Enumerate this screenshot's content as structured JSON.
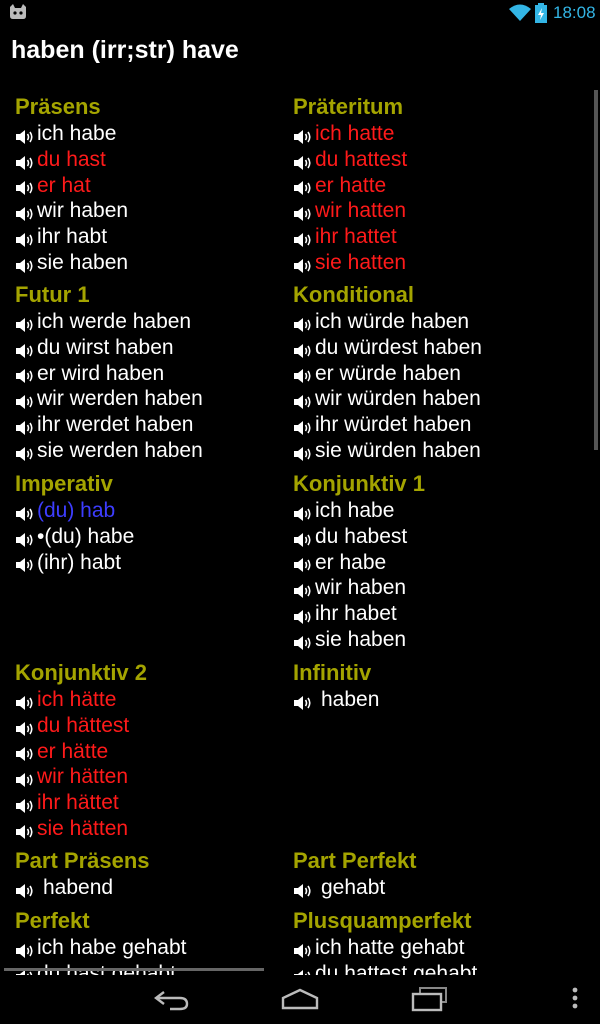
{
  "status": {
    "time": "18:08"
  },
  "title": "haben (irr;str) have",
  "sections": {
    "praesens": {
      "heading": "Präsens",
      "forms": [
        {
          "text": "ich habe",
          "irregular": false
        },
        {
          "text": "du hast",
          "irregular": true
        },
        {
          "text": "er hat",
          "irregular": true
        },
        {
          "text": "wir haben",
          "irregular": false
        },
        {
          "text": "ihr habt",
          "irregular": false
        },
        {
          "text": "sie haben",
          "irregular": false
        }
      ]
    },
    "praeteritum": {
      "heading": "Präteritum",
      "forms": [
        {
          "text": "ich hatte",
          "irregular": true
        },
        {
          "text": "du hattest",
          "irregular": true
        },
        {
          "text": "er hatte",
          "irregular": true
        },
        {
          "text": "wir hatten",
          "irregular": true
        },
        {
          "text": "ihr hattet",
          "irregular": true
        },
        {
          "text": "sie hatten",
          "irregular": true
        }
      ]
    },
    "futur1": {
      "heading": "Futur 1",
      "forms": [
        {
          "text": "ich werde haben"
        },
        {
          "text": "du wirst haben"
        },
        {
          "text": "er wird haben"
        },
        {
          "text": "wir werden haben"
        },
        {
          "text": "ihr werdet haben"
        },
        {
          "text": "sie werden haben"
        }
      ]
    },
    "konditional": {
      "heading": "Konditional",
      "forms": [
        {
          "text": "ich würde haben"
        },
        {
          "text": "du würdest haben"
        },
        {
          "text": "er würde haben"
        },
        {
          "text": "wir würden haben"
        },
        {
          "text": "ihr würdet haben"
        },
        {
          "text": "sie würden haben"
        }
      ]
    },
    "imperativ": {
      "heading": "Imperativ",
      "forms": [
        {
          "text": "(du) hab",
          "highlight": true
        },
        {
          "text": "•(du) habe"
        },
        {
          "text": "(ihr) habt"
        }
      ]
    },
    "konjunktiv1": {
      "heading": "Konjunktiv 1",
      "forms": [
        {
          "text": "ich habe"
        },
        {
          "text": "du habest"
        },
        {
          "text": "er habe"
        },
        {
          "text": "wir haben"
        },
        {
          "text": "ihr habet"
        },
        {
          "text": "sie haben"
        }
      ]
    },
    "konjunktiv2": {
      "heading": "Konjunktiv 2",
      "forms": [
        {
          "text": "ich hätte",
          "irregular": true
        },
        {
          "text": "du hättest",
          "irregular": true
        },
        {
          "text": "er hätte",
          "irregular": true
        },
        {
          "text": "wir hätten",
          "irregular": true
        },
        {
          "text": "ihr hättet",
          "irregular": true
        },
        {
          "text": "sie hätten",
          "irregular": true
        }
      ]
    },
    "infinitiv": {
      "heading": "Infinitiv",
      "forms": [
        {
          "text": "haben",
          "pad": true
        }
      ]
    },
    "part_praesens": {
      "heading": "Part Präsens",
      "forms": [
        {
          "text": "habend",
          "pad": true
        }
      ]
    },
    "part_perfekt": {
      "heading": "Part Perfekt",
      "forms": [
        {
          "text": "gehabt",
          "pad": true
        }
      ]
    },
    "perfekt": {
      "heading": "Perfekt",
      "forms": [
        {
          "text": "ich habe gehabt"
        },
        {
          "text": "du hast gehabt"
        }
      ]
    },
    "plusquamperfekt": {
      "heading": "Plusquamperfekt",
      "forms": [
        {
          "text": "ich hatte gehabt"
        },
        {
          "text": "du hattest gehabt"
        }
      ]
    }
  },
  "colors": {
    "heading": "#a4a400",
    "irregular": "#ff1a1a",
    "highlight": "#3d3dff",
    "normal": "#ffffff",
    "status_accent": "#33b5e5"
  }
}
